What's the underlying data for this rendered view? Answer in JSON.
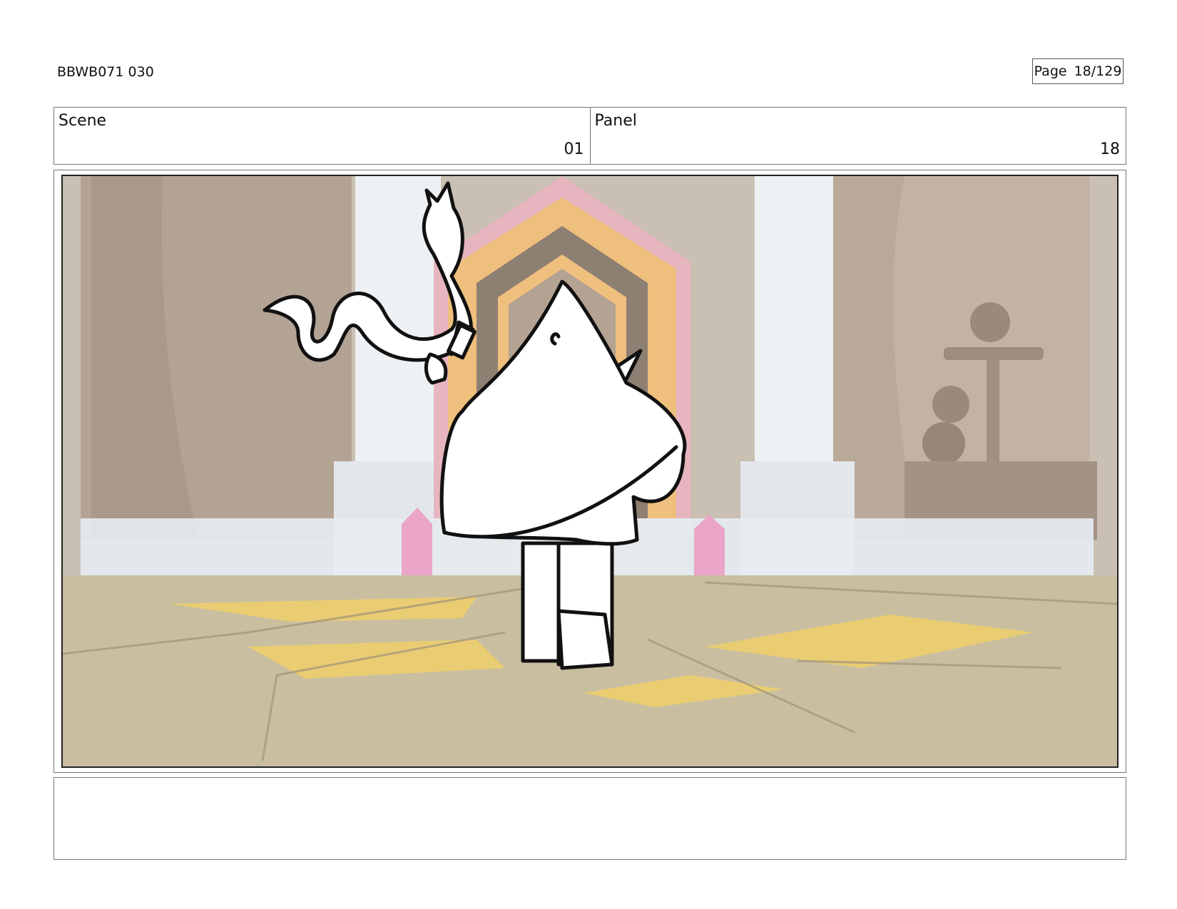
{
  "header": {
    "doc_id": "BBWB071 030",
    "page_label": "Page",
    "page_number": "18/129"
  },
  "fields": {
    "scene_label": "Scene",
    "scene_value": "01",
    "panel_label": "Panel",
    "panel_value": "18"
  },
  "panel": {
    "description_icons": [
      "temple-background",
      "glowing-doorway",
      "pink-crystal",
      "snake-creature",
      "cloaked-character"
    ]
  },
  "notes": {
    "text": ""
  },
  "colors": {
    "border": "#777777",
    "wall": "#b7a99a",
    "pillar": "#eef1f3",
    "floor": "#c9bfa0",
    "floor_glow": "#f0cf6a",
    "door_pink": "#e7b5bf",
    "door_orange": "#efbf7d",
    "crystal": "#eaa5c8"
  }
}
